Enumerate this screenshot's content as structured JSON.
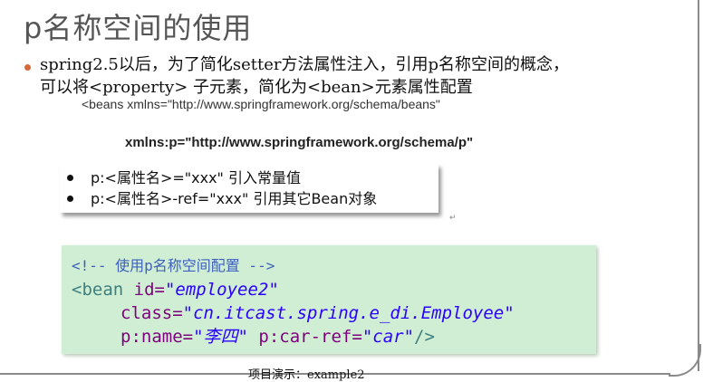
{
  "title": "p名称空间的使用",
  "bullet": {
    "line1": "spring2.5以后，为了简化setter方法属性注入，引用p名称空间的概念，",
    "line2": "可以将<property> 子元素，简化为<bean>元素属性配置"
  },
  "xmlns_beans": "<beans xmlns=\"http://www.springframework.org/schema/beans\"",
  "xmlns_p": "xmlns:p=\"http://www.springframework.org/schema/p\"",
  "box_items": [
    "p:<属性名>=\"xxx\" 引入常量值",
    "p:<属性名>-ref=\"xxx\" 引用其它Bean对象"
  ],
  "para_mark": "↵",
  "code": {
    "comment": "<!-- 使用p名称空间配置 -->",
    "bean_open": "<bean ",
    "id_attr": "id=",
    "id_val": "\"employee2\"",
    "class_attr": "class=",
    "class_val": "\"cn.itcast.spring.e_di.Employee\"",
    "name_attr": "p:name=",
    "name_val": "\"李四\"",
    "car_attr": " p:car-ref=",
    "car_val": "\"car\"",
    "close": "/>"
  },
  "caption": "项目演示：example2"
}
